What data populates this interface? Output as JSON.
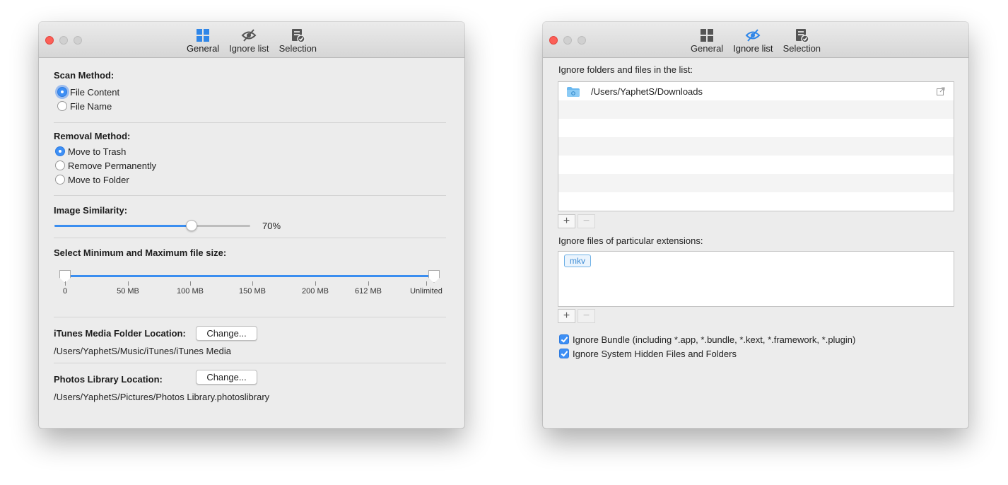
{
  "colors": {
    "accent": "#3d8ff5",
    "close": "#fc5f57"
  },
  "toolbar": [
    {
      "label": "General",
      "icon": "grid-icon"
    },
    {
      "label": "Ignore list",
      "icon": "eye-slash-icon"
    },
    {
      "label": "Selection",
      "icon": "checklist-icon"
    }
  ],
  "left": {
    "active_tab": "General",
    "scan": {
      "title": "Scan Method:",
      "options": [
        "File Content",
        "File Name"
      ],
      "selected": "File Content"
    },
    "removal": {
      "title": "Removal Method:",
      "options": [
        "Move to Trash",
        "Remove Permanently",
        "Move to Folder"
      ],
      "selected": "Move to Trash"
    },
    "similarity": {
      "title": "Image Similarity:",
      "value": 70,
      "value_label": "70%"
    },
    "filesize": {
      "title": "Select Minimum and Maximum file size:",
      "ticks": [
        "0",
        "50 MB",
        "100 MB",
        "150 MB",
        "200 MB",
        "612 MB",
        "Unlimited"
      ],
      "min": "0",
      "max": "Unlimited"
    },
    "itunes": {
      "label": "iTunes Media Folder Location:",
      "button": "Change...",
      "path": "/Users/YaphetS/Music/iTunes/iTunes Media"
    },
    "photos": {
      "label": "Photos Library Location:",
      "button": "Change...",
      "path": "/Users/YaphetS/Pictures/Photos Library.photoslibrary"
    }
  },
  "right": {
    "active_tab": "Ignore list",
    "folders": {
      "title": "Ignore folders and files in the list:",
      "items": [
        "/Users/YaphetS/Downloads"
      ]
    },
    "extensions": {
      "title": "Ignore files of particular extensions:",
      "tags": [
        "mkv"
      ]
    },
    "options": [
      {
        "label": "Ignore Bundle (including *.app, *.bundle, *.kext, *.framework, *.plugin)",
        "checked": true
      },
      {
        "label": "Ignore System Hidden Files and Folders",
        "checked": true
      }
    ],
    "add_label": "+",
    "remove_label": "−"
  }
}
